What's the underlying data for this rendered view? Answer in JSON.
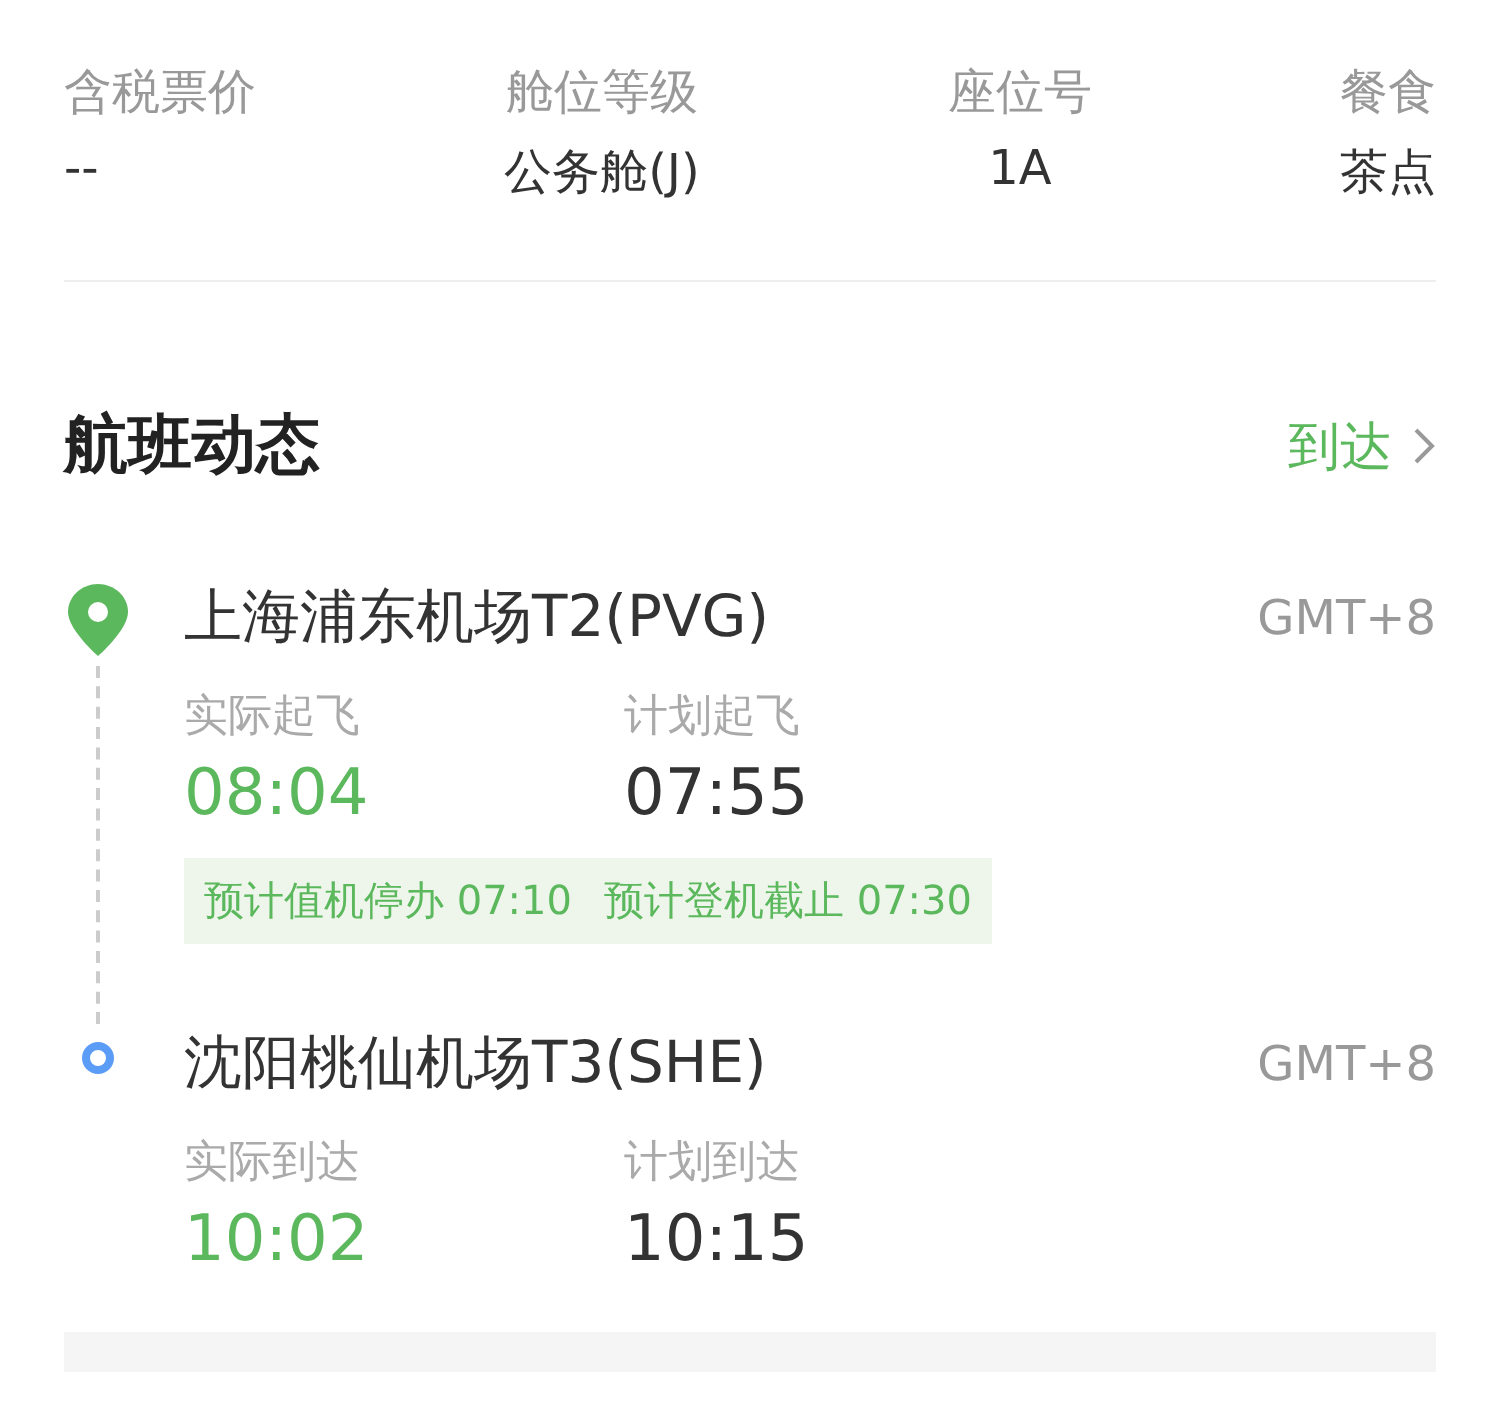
{
  "info": [
    {
      "label": "含税票价",
      "value": "--"
    },
    {
      "label": "舱位等级",
      "value": "公务舱(J)"
    },
    {
      "label": "座位号",
      "value": "1A"
    },
    {
      "label": "餐食",
      "value": "茶点"
    }
  ],
  "section": {
    "title": "航班动态",
    "link": "到达"
  },
  "stops": [
    {
      "kind": "departure",
      "airport": "上海浦东机场T2(PVG)",
      "timezone": "GMT+8",
      "times": [
        {
          "kind": "actual",
          "label": "实际起飞",
          "value": "08:04"
        },
        {
          "kind": "planned",
          "label": "计划起飞",
          "value": "07:55"
        }
      ],
      "notices": [
        "预计值机停办 07:10",
        "预计登机截止 07:30"
      ]
    },
    {
      "kind": "arrival",
      "airport": "沈阳桃仙机场T3(SHE)",
      "timezone": "GMT+8",
      "times": [
        {
          "kind": "actual",
          "label": "实际到达",
          "value": "10:02"
        },
        {
          "kind": "planned",
          "label": "计划到达",
          "value": "10:15"
        }
      ]
    }
  ]
}
